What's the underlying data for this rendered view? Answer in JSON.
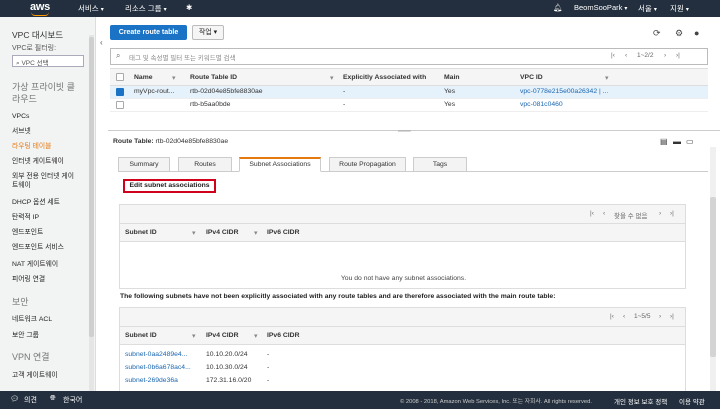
{
  "topbar": {
    "logo": "aws",
    "services_label": "서비스",
    "resource_groups_label": "리소스 그룹",
    "user_label": "BeomSooPark",
    "region_label": "서울",
    "support_label": "지원"
  },
  "sidebar": {
    "title": "VPC 대시보드",
    "filter_label": "VPC로 필터링:",
    "filter_placeholder": "VPC 선택",
    "group_vpc": "가상 프라이빗 클\n라우드",
    "items": [
      {
        "label": "VPCs"
      },
      {
        "label": "서브넷"
      },
      {
        "label": "라우팅 테이블"
      },
      {
        "label": "인터넷 게이트웨이"
      },
      {
        "label": "외부 전용 인터넷 게이\n트웨이"
      },
      {
        "label": "DHCP 옵션 세트"
      },
      {
        "label": "탄력적 IP"
      },
      {
        "label": "엔드포인트"
      },
      {
        "label": "엔드포인트 서비스"
      },
      {
        "label": "NAT 게이트웨이"
      },
      {
        "label": "피어링 연결"
      }
    ],
    "group_security": "보안",
    "security_items": [
      {
        "label": "네트워크 ACL"
      },
      {
        "label": "보안 그룹"
      }
    ],
    "group_vpn": "VPN 연결",
    "vpn_items": [
      {
        "label": "고객 게이트웨이"
      }
    ]
  },
  "toolbar": {
    "create_label": "Create route table",
    "actions_label": "작업"
  },
  "filter": {
    "placeholder": "태그 및 속성별 필터 또는 키워드별 검색",
    "pager": "1~2/2"
  },
  "route_tables": {
    "columns": [
      "Name",
      "Route Table ID",
      "Explicitly Associated with",
      "Main",
      "VPC ID"
    ],
    "rows": [
      {
        "name": "myVpc-rout...",
        "id": "rtb-02d04e85bfe8830ae",
        "assoc": "-",
        "main": "Yes",
        "vpc": "vpc-0778e215e00a26342 | ..."
      },
      {
        "name": "",
        "id": "rtb-b5aa0bde",
        "assoc": "-",
        "main": "Yes",
        "vpc": "vpc-081c0460"
      }
    ]
  },
  "detail": {
    "label": "Route Table:",
    "value": "rtb-02d04e85bfe8830ae",
    "tabs": [
      "Summary",
      "Routes",
      "Subnet Associations",
      "Route Propagation",
      "Tags"
    ],
    "active_tab": "Subnet Associations",
    "edit_label": "Edit subnet associations",
    "assoc_pager": "찾을 수 없음",
    "assoc_columns": [
      "Subnet ID",
      "IPv4 CIDR",
      "IPv6 CIDR"
    ],
    "empty_message": "You do not have any subnet associations.",
    "note": "The following subnets have not been explicitly associated with any route tables and are therefore associated with the main route table:",
    "unassoc_pager": "1~5/5",
    "unassoc_columns": [
      "Subnet ID",
      "IPv4 CIDR",
      "IPv6 CIDR"
    ],
    "unassoc_rows": [
      {
        "id": "subnet-0aa2489e4...",
        "ipv4": "10.10.20.0/24",
        "ipv6": "-"
      },
      {
        "id": "subnet-0b6a678ac4...",
        "ipv4": "10.10.30.0/24",
        "ipv6": "-"
      },
      {
        "id": "subnet-269de36a",
        "ipv4": "172.31.16.0/20",
        "ipv6": "-"
      }
    ]
  },
  "footer": {
    "feedback": "의견",
    "language": "한국어",
    "copyright": "© 2008 - 2018, Amazon Web Services, Inc. 또는 자회사. All rights reserved.",
    "privacy": "개인 정보 보호 정책",
    "terms": "이용 약관"
  }
}
